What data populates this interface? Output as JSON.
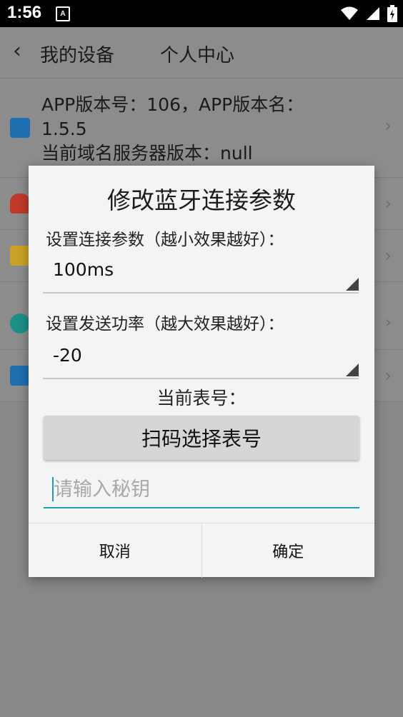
{
  "status_bar": {
    "time": "1:56",
    "notification_icon": "A",
    "icons": [
      "wifi-icon",
      "signal-icon",
      "battery-icon"
    ]
  },
  "header": {
    "title": "我的设备",
    "subtitle": "个人中心"
  },
  "info_row": {
    "line1": "APP版本号：106，APP版本名：",
    "line2": "1.5.5",
    "line3": "当前域名服务器版本：null"
  },
  "dialog": {
    "title": "修改蓝牙连接参数",
    "connect_param_label": "设置连接参数（越小效果越好）：",
    "connect_param_value": "100ms",
    "tx_power_label": "设置发送功率（越大效果越好）：",
    "tx_power_value": "-20",
    "current_meter_label": "当前表号：",
    "scan_button": "扫码选择表号",
    "secret_key_placeholder": "请输入秘钥",
    "secret_key_value": "",
    "cancel": "取消",
    "confirm": "确定"
  },
  "colors": {
    "accent": "#1b9bb8",
    "icon_blue": "#1f6fb0",
    "icon_red": "#c0392b",
    "icon_yellow": "#c9a227",
    "icon_teal": "#1e8f86"
  }
}
